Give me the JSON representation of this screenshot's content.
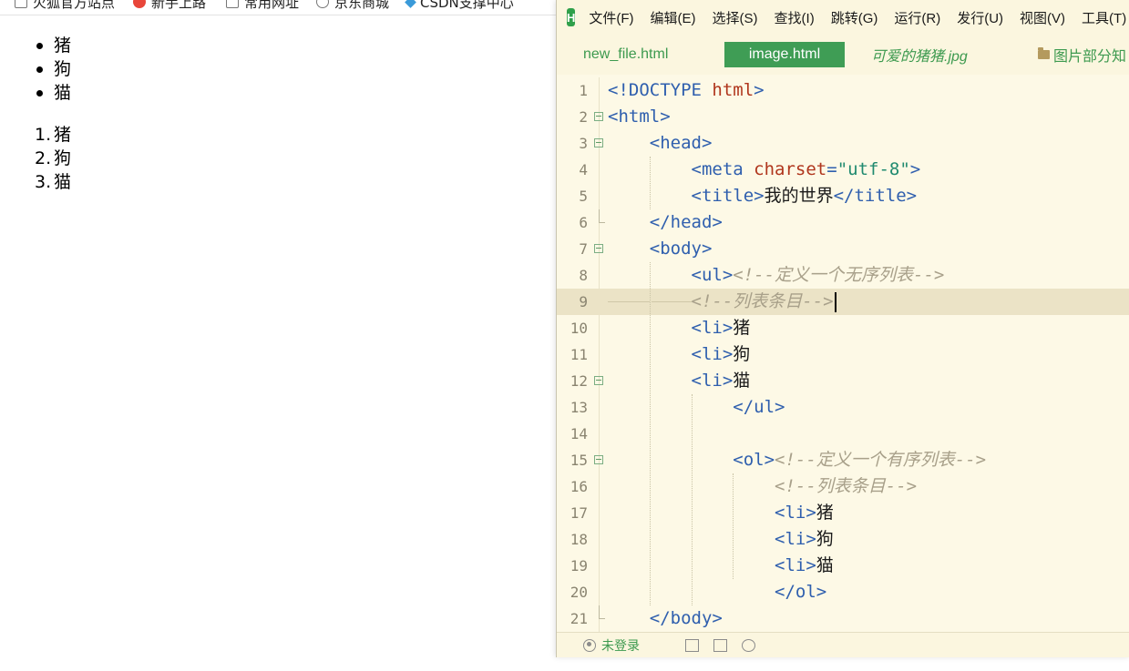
{
  "bookmarks": [
    {
      "label": "火狐官方站点",
      "icon": "firefox-page-icon"
    },
    {
      "label": "新手上路",
      "icon": "firefox-icon"
    },
    {
      "label": "常用网址",
      "icon": "folder-icon"
    },
    {
      "label": "京东商城",
      "icon": "globe-icon"
    },
    {
      "label": "CSDN支撑中心",
      "icon": "csdn-icon"
    }
  ],
  "preview": {
    "unordered": [
      "猪",
      "狗",
      "猫"
    ],
    "ordered": [
      {
        "num": "1.",
        "text": "猪"
      },
      {
        "num": "2.",
        "text": "狗"
      },
      {
        "num": "3.",
        "text": "猫"
      }
    ]
  },
  "editor": {
    "logo": "H",
    "menu": [
      "文件(F)",
      "编辑(E)",
      "选择(S)",
      "查找(I)",
      "跳转(G)",
      "运行(R)",
      "发行(U)",
      "视图(V)",
      "工具(T)"
    ],
    "tabs": [
      "new_file.html",
      "image.html",
      "可爱的猪猪.jpg",
      "图片部分知"
    ],
    "active_tab": "image.html",
    "lines": [
      {
        "n": "1",
        "parts": [
          [
            "<!DOCTYPE ",
            "tag"
          ],
          [
            "html",
            "kw"
          ],
          [
            ">",
            "tag"
          ]
        ]
      },
      {
        "n": "2",
        "parts": [
          [
            "<html>",
            "tag"
          ]
        ]
      },
      {
        "n": "3",
        "parts": [
          [
            "    <head>",
            "tag"
          ]
        ]
      },
      {
        "n": "4",
        "parts": [
          [
            "        <meta ",
            "tag"
          ],
          [
            "charset",
            "kw"
          ],
          [
            "=",
            "tag"
          ],
          [
            "\"utf-8\"",
            "str"
          ],
          [
            ">",
            "tag"
          ]
        ]
      },
      {
        "n": "5",
        "parts": [
          [
            "        <title>",
            "tag"
          ],
          [
            "我的世界",
            "txt"
          ],
          [
            "</title>",
            "tag"
          ]
        ]
      },
      {
        "n": "6",
        "parts": [
          [
            "    </head>",
            "tag"
          ]
        ]
      },
      {
        "n": "7",
        "parts": [
          [
            "    <body>",
            "tag"
          ]
        ]
      },
      {
        "n": "8",
        "parts": [
          [
            "        <ul>",
            "tag"
          ],
          [
            "<!--定义一个无序列表-->",
            "com"
          ]
        ]
      },
      {
        "n": "9",
        "parts": [
          [
            "        ",
            "tag"
          ],
          [
            "<!--列表条目-->",
            "com"
          ]
        ]
      },
      {
        "n": "10",
        "parts": [
          [
            "        <li>",
            "tag"
          ],
          [
            "猪",
            "txt"
          ]
        ]
      },
      {
        "n": "11",
        "parts": [
          [
            "        <li>",
            "tag"
          ],
          [
            "狗",
            "txt"
          ]
        ]
      },
      {
        "n": "12",
        "parts": [
          [
            "        <li>",
            "tag"
          ],
          [
            "猫",
            "txt"
          ]
        ]
      },
      {
        "n": "13",
        "parts": [
          [
            "            </ul>",
            "tag"
          ]
        ]
      },
      {
        "n": "14",
        "parts": [
          [
            "",
            "tag"
          ]
        ]
      },
      {
        "n": "15",
        "parts": [
          [
            "            <ol>",
            "tag"
          ],
          [
            "<!--定义一个有序列表-->",
            "com"
          ]
        ]
      },
      {
        "n": "16",
        "parts": [
          [
            "                ",
            "tag"
          ],
          [
            "<!--列表条目-->",
            "com"
          ]
        ]
      },
      {
        "n": "17",
        "parts": [
          [
            "                <li>",
            "tag"
          ],
          [
            "猪",
            "txt"
          ]
        ]
      },
      {
        "n": "18",
        "parts": [
          [
            "                <li>",
            "tag"
          ],
          [
            "狗",
            "txt"
          ]
        ]
      },
      {
        "n": "19",
        "parts": [
          [
            "                <li>",
            "tag"
          ],
          [
            "猫",
            "txt"
          ]
        ]
      },
      {
        "n": "20",
        "parts": [
          [
            "                </ol>",
            "tag"
          ]
        ]
      },
      {
        "n": "21",
        "parts": [
          [
            "    </body>",
            "tag"
          ]
        ]
      }
    ],
    "fold_open_lines": [
      "2",
      "3",
      "7",
      "12",
      "15"
    ],
    "fold_end_lines": [
      "6",
      "21"
    ],
    "current_line": "9",
    "status": {
      "login": "未登录"
    }
  }
}
